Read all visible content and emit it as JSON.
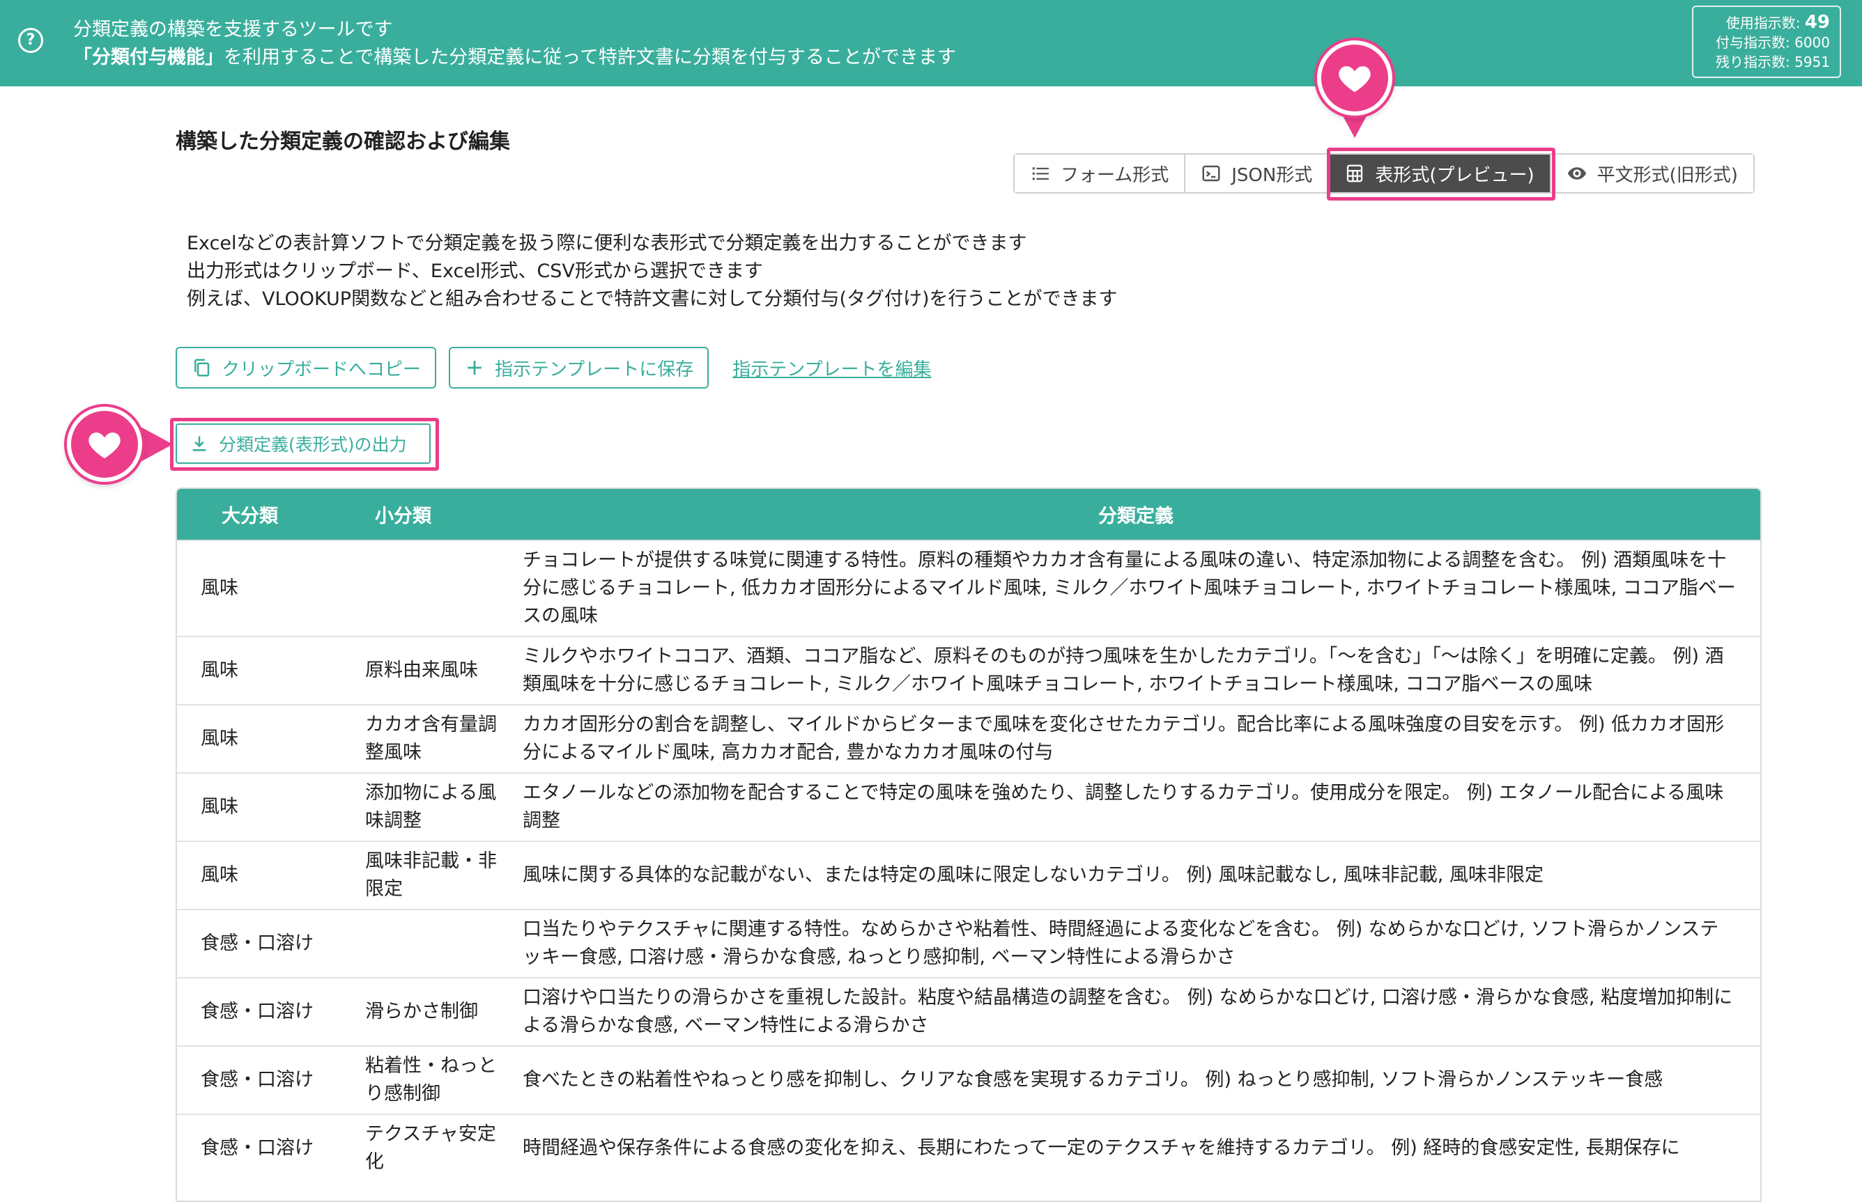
{
  "banner": {
    "line1": "分類定義の構築を支援するツールです",
    "line2_bold": "「分類付与機能」",
    "line2_rest": "を利用することで構築した分類定義に従って特許文書に分類を付与することができます"
  },
  "usage": {
    "used_label": "使用指示数:",
    "used_value": "49",
    "granted": "付与指示数: 6000",
    "remaining": "残り指示数: 5951"
  },
  "section_title": "構築した分類定義の確認および編集",
  "modes": [
    {
      "label": "フォーム形式",
      "icon": "list-icon"
    },
    {
      "label": "JSON形式",
      "icon": "terminal-icon"
    },
    {
      "label": "表形式(プレビュー)",
      "icon": "table-icon",
      "active": true
    },
    {
      "label": "平文形式(旧形式)",
      "icon": "eye-icon"
    }
  ],
  "description": [
    "Excelなどの表計算ソフトで分類定義を扱う際に便利な表形式で分類定義を出力することができます",
    "出力形式はクリップボード、Excel形式、CSV形式から選択できます",
    "例えば、VLOOKUP関数などと組み合わせることで特許文書に対して分類付与(タグ付け)を行うことができます"
  ],
  "actions": {
    "copy_label": "クリップボードへコピー",
    "save_template_label": "指示テンプレートに保存",
    "edit_template_link": "指示テンプレートを編集",
    "export_label": "分類定義(表形式)の出力"
  },
  "accent_color": "#3aae9c",
  "highlight_color": "#ec3d8a",
  "table": {
    "headers": [
      "大分類",
      "小分類",
      "分類定義"
    ],
    "rows": [
      {
        "major": "風味",
        "minor": "",
        "def": "チョコレートが提供する味覚に関連する特性。原料の種類やカカオ含有量による風味の違い、特定添加物による調整を含む。 例) 酒類風味を十分に感じるチョコレート, 低カカオ固形分によるマイルド風味, ミルク／ホワイト風味チョコレート, ホワイトチョコレート様風味, ココア脂ベースの風味"
      },
      {
        "major": "風味",
        "minor": "原料由来風味",
        "def": "ミルクやホワイトココア、酒類、ココア脂など、原料そのものが持つ風味を生かしたカテゴリ。「〜を含む」「〜は除く」を明確に定義。 例) 酒類風味を十分に感じるチョコレート, ミルク／ホワイト風味チョコレート, ホワイトチョコレート様風味, ココア脂ベースの風味"
      },
      {
        "major": "風味",
        "minor": "カカオ含有量調整風味",
        "def": "カカオ固形分の割合を調整し、マイルドからビターまで風味を変化させたカテゴリ。配合比率による風味強度の目安を示す。 例) 低カカオ固形分によるマイルド風味, 高カカオ配合, 豊かなカカオ風味の付与"
      },
      {
        "major": "風味",
        "minor": "添加物による風味調整",
        "def": "エタノールなどの添加物を配合することで特定の風味を強めたり、調整したりするカテゴリ。使用成分を限定。 例) エタノール配合による風味調整"
      },
      {
        "major": "風味",
        "minor": "風味非記載・非限定",
        "def": "風味に関する具体的な記載がない、または特定の風味に限定しないカテゴリ。 例) 風味記載なし, 風味非記載, 風味非限定"
      },
      {
        "major": "食感・口溶け",
        "minor": "",
        "def": "口当たりやテクスチャに関連する特性。なめらかさや粘着性、時間経過による変化などを含む。 例) なめらかな口どけ, ソフト滑らかノンステッキー食感, 口溶け感・滑らかな食感, ねっとり感抑制, ベーマン特性による滑らかさ"
      },
      {
        "major": "食感・口溶け",
        "minor": "滑らかさ制御",
        "def": "口溶けや口当たりの滑らかさを重視した設計。粘度や結晶構造の調整を含む。 例) なめらかな口どけ, 口溶け感・滑らかな食感, 粘度増加抑制による滑らかな食感, ベーマン特性による滑らかさ"
      },
      {
        "major": "食感・口溶け",
        "minor": "粘着性・ねっとり感制御",
        "def": "食べたときの粘着性やねっとり感を抑制し、クリアな食感を実現するカテゴリ。 例) ねっとり感抑制, ソフト滑らかノンステッキー食感"
      },
      {
        "major": "食感・口溶け",
        "minor": "テクスチャ安定化",
        "def": "時間経過や保存条件による食感の変化を抑え、長期にわたって一定のテクスチャを維持するカテゴリ。 例) 経時的食感安定性, 長期保存に"
      }
    ]
  }
}
